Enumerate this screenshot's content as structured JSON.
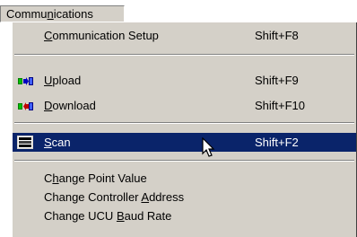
{
  "menubar": {
    "item": {
      "before": "Commu",
      "accel": "n",
      "after": "ications"
    }
  },
  "menu": {
    "items": [
      {
        "before": "",
        "accel": "C",
        "after": "ommunication Setup",
        "shortcut": "Shift+F8",
        "icon": "none"
      },
      {
        "before": "",
        "accel": "U",
        "after": "pload",
        "shortcut": "Shift+F9",
        "icon": "upload-icon"
      },
      {
        "before": "",
        "accel": "D",
        "after": "ownload",
        "shortcut": "Shift+F10",
        "icon": "download-icon"
      },
      {
        "before": "",
        "accel": "S",
        "after": "can",
        "shortcut": "Shift+F2",
        "icon": "scan-icon",
        "highlighted": true
      },
      {
        "before": "C",
        "accel": "h",
        "after": "ange Point Value",
        "shortcut": "",
        "icon": "none"
      },
      {
        "before": "Change Controller ",
        "accel": "A",
        "after": "ddress",
        "shortcut": "",
        "icon": "none"
      },
      {
        "before": "Change UCU ",
        "accel": "B",
        "after": "aud Rate",
        "shortcut": "",
        "icon": "none"
      }
    ]
  },
  "colors": {
    "menu_bg": "#d4d0c8",
    "highlight_bg": "#0a246a",
    "highlight_fg": "#ffffff"
  }
}
